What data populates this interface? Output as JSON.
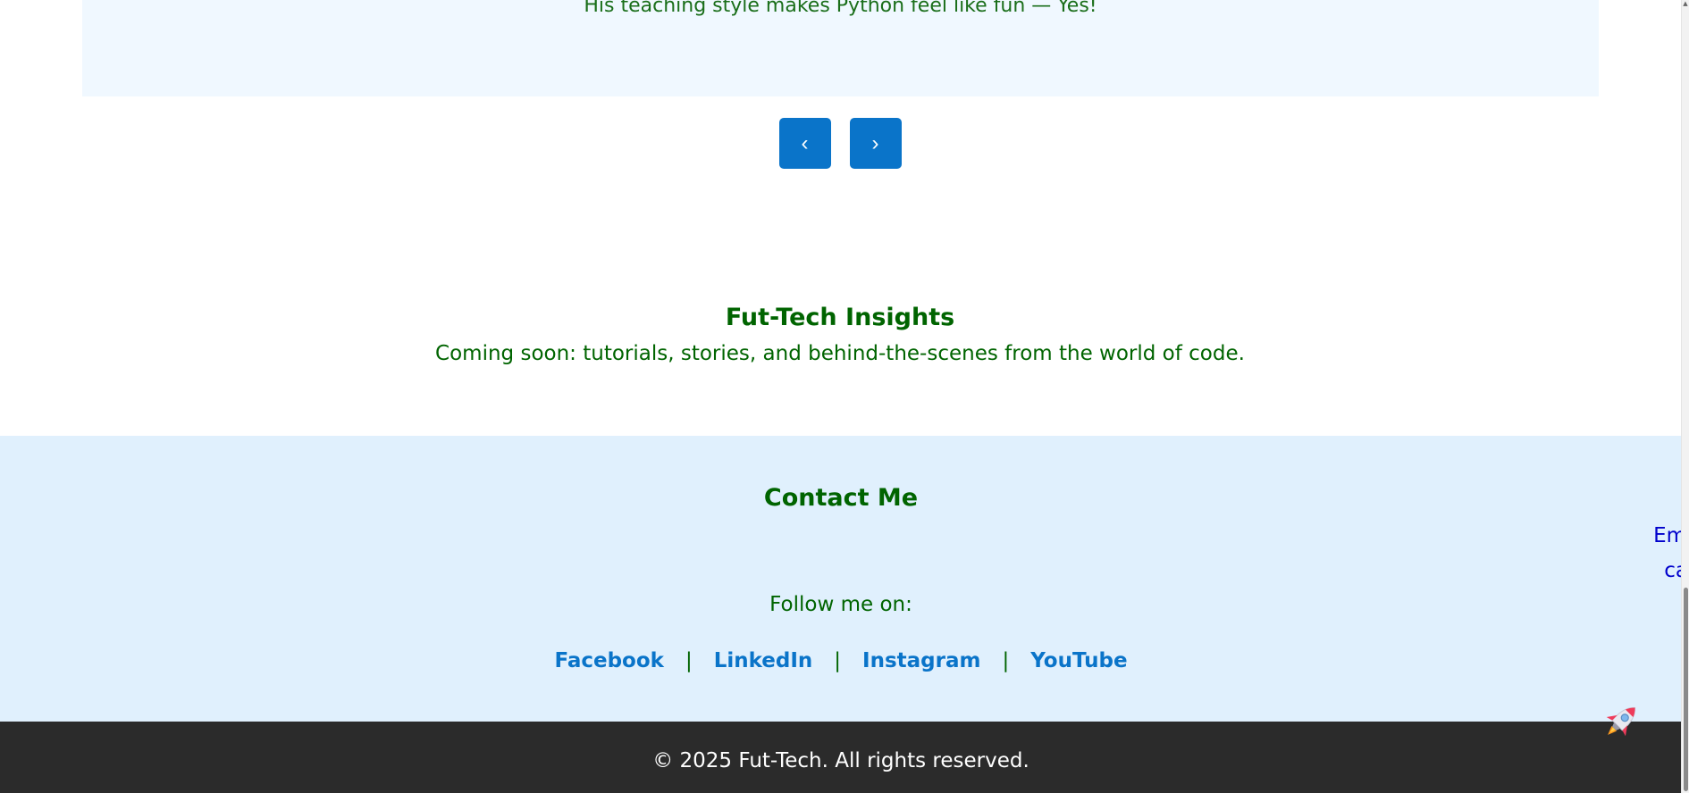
{
  "testimonial": {
    "quote": "His teaching style makes Python feel like fun — Yes!"
  },
  "carousel": {
    "prev_label": "‹",
    "next_label": "›"
  },
  "insights": {
    "title": "Fut-Tech Insights",
    "text": "Coming soon: tutorials, stories, and behind-the-scenes from the world of code."
  },
  "contact": {
    "title": "Contact Me",
    "email_label": "Email",
    "call_label": "call",
    "follow_text": "Follow me on:",
    "social": [
      {
        "label": "Facebook"
      },
      {
        "label": "LinkedIn"
      },
      {
        "label": "Instagram"
      },
      {
        "label": "YouTube"
      }
    ],
    "separator": "|"
  },
  "footer": {
    "copyright": "© 2025 Fut-Tech. All rights reserved."
  },
  "colors": {
    "accent": "#0a74c9",
    "heading_green": "#006400",
    "link_blue": "#0000cc",
    "contact_bg": "#e0f0fd",
    "footer_bg": "#2b2b2b"
  },
  "icons": {
    "back_to_top": "rocket-icon"
  }
}
